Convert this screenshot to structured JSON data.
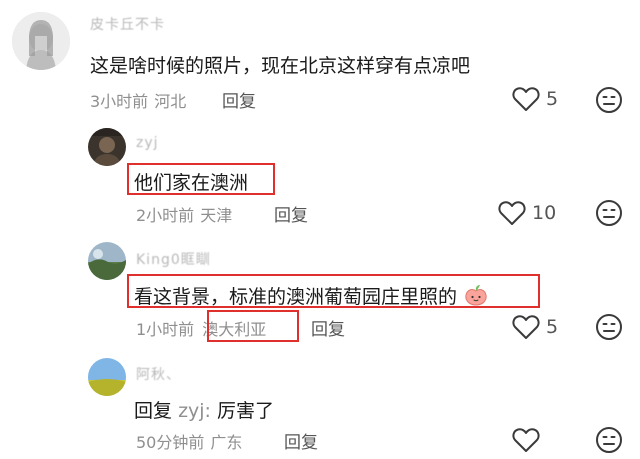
{
  "comments": [
    {
      "username": "皮卡丘不卡",
      "text": "这是啥时候的照片，现在北京这样穿有点凉吧",
      "time": "3小时前",
      "location": "河北",
      "reply_label": "回复",
      "likes": "5"
    },
    {
      "username": "zyj",
      "text": "他们家在澳洲",
      "time": "2小时前",
      "location": "天津",
      "reply_label": "回复",
      "likes": "10"
    },
    {
      "username": "King0眶瞓",
      "text": "看这背景，标准的澳洲葡萄园庄里照的",
      "time": "1小时前",
      "location": "澳大利亚",
      "reply_label": "回复",
      "likes": "5"
    },
    {
      "username": "阿秋、",
      "reply_prefix": "回复",
      "reply_to": "zyj:",
      "text": "厉害了",
      "time": "50分钟前",
      "location": "广东",
      "reply_label": "回复",
      "likes": ""
    }
  ],
  "colors": {
    "highlight_box": "#e0302e",
    "meta_text": "#8f8f8f",
    "body_text": "#1a1a1a"
  },
  "icons": [
    "heart-outline-icon",
    "meh-face-icon",
    "peach-emoji"
  ]
}
